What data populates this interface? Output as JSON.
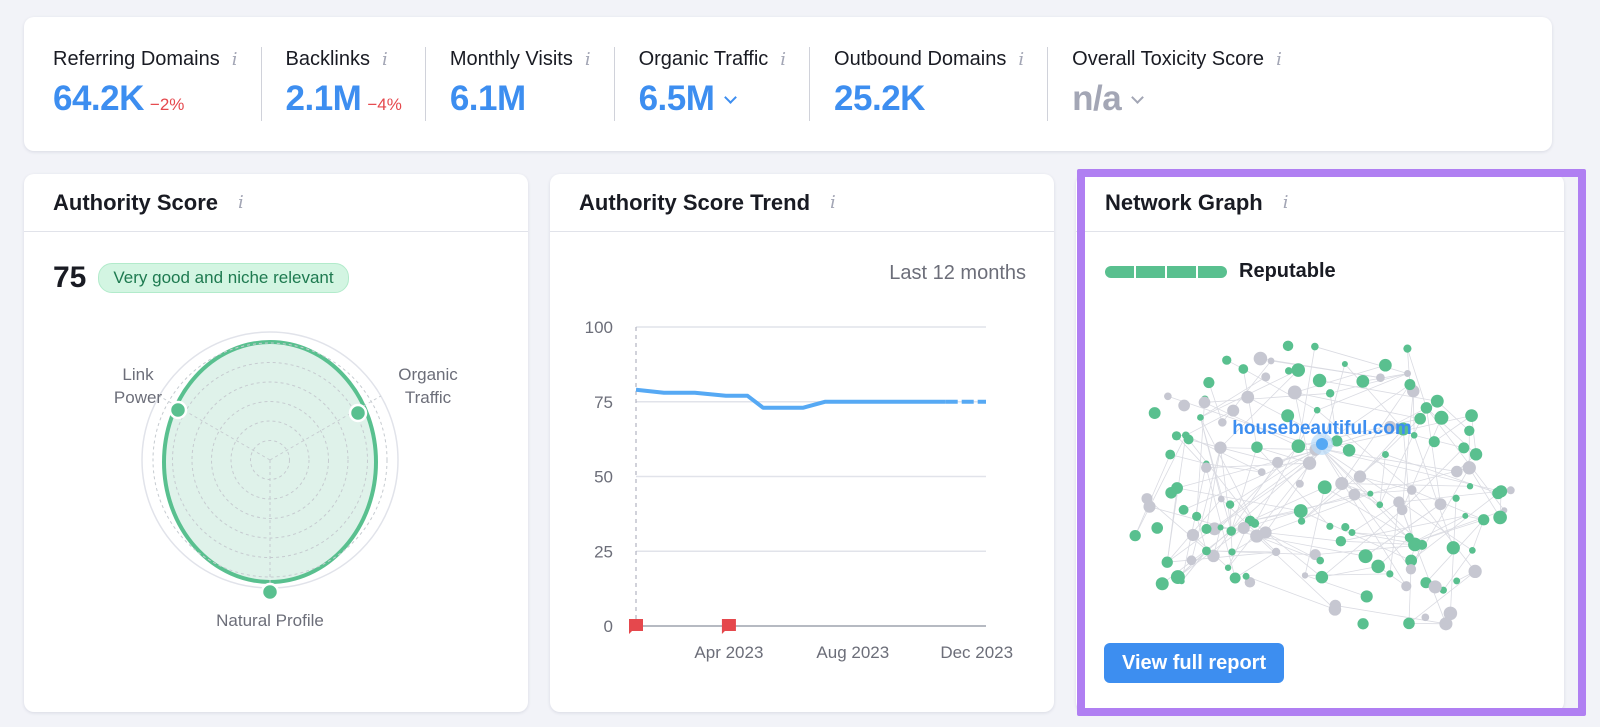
{
  "metrics": [
    {
      "label": "Referring Domains",
      "value": "64.2K",
      "delta": "−2%",
      "dropdown": false,
      "muted": false
    },
    {
      "label": "Backlinks",
      "value": "2.1M",
      "delta": "−4%",
      "dropdown": false,
      "muted": false
    },
    {
      "label": "Monthly Visits",
      "value": "6.1M",
      "delta": "",
      "dropdown": false,
      "muted": false
    },
    {
      "label": "Organic Traffic",
      "value": "6.5M",
      "delta": "",
      "dropdown": true,
      "muted": false
    },
    {
      "label": "Outbound Domains",
      "value": "25.2K",
      "delta": "",
      "dropdown": false,
      "muted": false
    },
    {
      "label": "Overall Toxicity Score",
      "value": "n/a",
      "delta": "",
      "dropdown": true,
      "muted": true
    }
  ],
  "info_icon": "i",
  "authority_score": {
    "title": "Authority Score",
    "score": "75",
    "badge": "Very good and niche relevant",
    "radar": {
      "axes": [
        "Link Power",
        "Organic Traffic",
        "Natural Profile"
      ],
      "axis_label_lines": [
        [
          "Link",
          "Power"
        ],
        [
          "Organic",
          "Traffic"
        ],
        [
          "Natural Profile"
        ]
      ],
      "values": [
        0.9,
        0.9,
        1.0
      ],
      "rings": 6
    }
  },
  "trend": {
    "title": "Authority Score Trend",
    "period": "Last 12 months",
    "chart_data": {
      "type": "line",
      "title": "Authority Score Trend",
      "xlabel": "",
      "ylabel": "",
      "ylim": [
        0,
        100
      ],
      "yticks": [
        "0",
        "25",
        "50",
        "75",
        "100"
      ],
      "xticks": [
        {
          "label": "Apr 2023",
          "month": 3
        },
        {
          "label": "Aug 2023",
          "month": 7
        },
        {
          "label": "Dec 2023",
          "month": 11
        }
      ],
      "x_months": [
        0,
        0.9,
        1.9,
        2.9,
        3.6,
        4.1,
        4.6,
        5.4,
        6.1,
        7.0,
        8.0,
        9.0,
        10.0,
        11.0
      ],
      "values": [
        79,
        78,
        78,
        77,
        77,
        73,
        73,
        73,
        75,
        75,
        75,
        75,
        75,
        75
      ],
      "dashed_from_month": 10,
      "flags": [
        0,
        3
      ],
      "grid": true
    }
  },
  "network": {
    "title": "Network Graph",
    "status": "Reputable",
    "status_segments": 4,
    "center_domain": "housebeautiful.com",
    "button": "View full report"
  },
  "colors": {
    "accent": "#3d8ef0",
    "green": "#59c08f",
    "gray_node": "#c6c7d1",
    "negative": "#e5484d",
    "highlight": "#b07ff2"
  }
}
